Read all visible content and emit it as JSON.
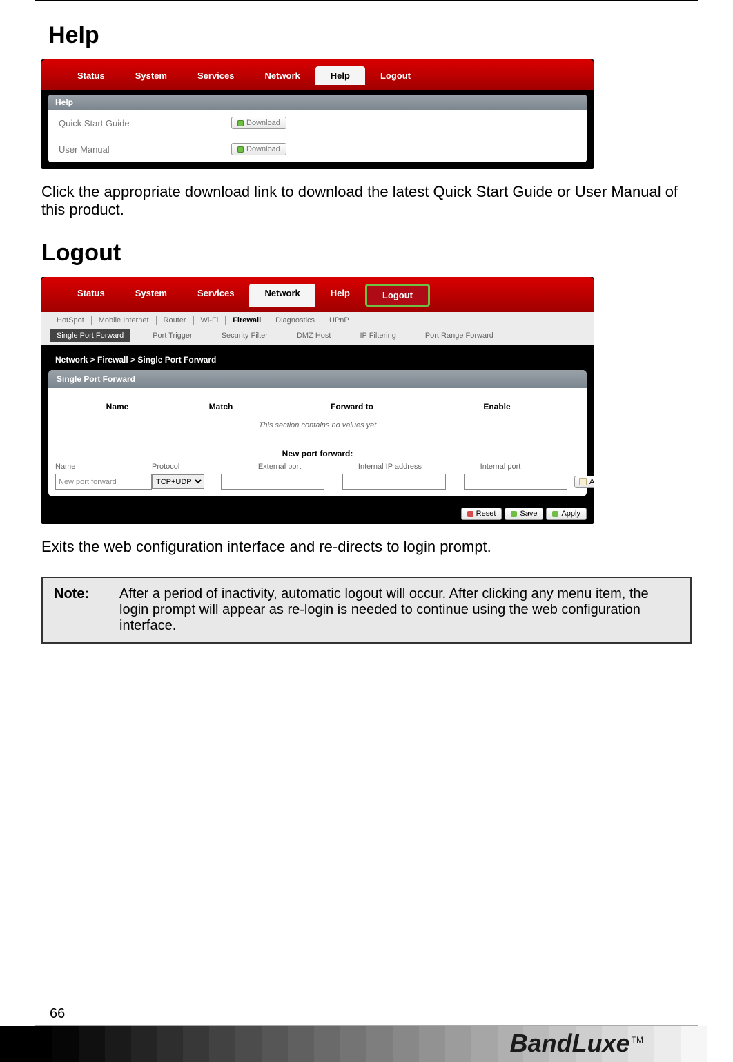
{
  "section1": {
    "title": "Help",
    "nav": {
      "items": [
        "Status",
        "System",
        "Services",
        "Network",
        "Help",
        "Logout"
      ],
      "active_index": 4
    },
    "inner_header": "Help",
    "rows": [
      {
        "label": "Quick Start Guide",
        "button": "Download"
      },
      {
        "label": "User Manual",
        "button": "Download"
      }
    ],
    "paragraph": "Click the appropriate download link to download the latest Quick Start Guide or User Manual of this product."
  },
  "section2": {
    "title": "Logout",
    "nav": {
      "items": [
        "Status",
        "System",
        "Services",
        "Network",
        "Help",
        "Logout"
      ],
      "active_index": 3,
      "highlight_index": 5
    },
    "subnav1": {
      "items": [
        "HotSpot",
        "Mobile Internet",
        "Router",
        "Wi-Fi",
        "Firewall",
        "Diagnostics",
        "UPnP"
      ],
      "active_index": 4
    },
    "subnav2": {
      "items": [
        "Single Port Forward",
        "Port Trigger",
        "Security Filter",
        "DMZ Host",
        "IP Filtering",
        "Port Range Forward"
      ],
      "active_index": 0
    },
    "breadcrumb": "Network > Firewall > Single Port Forward",
    "card_header": "Single Port Forward",
    "columns": [
      "Name",
      "Match",
      "Forward to",
      "Enable"
    ],
    "empty_text": "This section contains no values yet",
    "new_port_title": "New port forward:",
    "form_headers": [
      "Name",
      "Protocol",
      "External port",
      "Internal IP address",
      "Internal port"
    ],
    "form": {
      "name_placeholder": "New port forward",
      "protocol_value": "TCP+UDP",
      "add_button": "Add"
    },
    "buttons": {
      "reset": "Reset",
      "save": "Save",
      "apply": "Apply"
    },
    "paragraph": "Exits the web configuration interface and re-directs to login prompt."
  },
  "note": {
    "label": "Note:",
    "text": "After a period of inactivity, automatic logout will occur. After clicking any menu item, the login prompt will appear as re-login is needed to continue using the web configuration interface."
  },
  "footer": {
    "page_number": "66",
    "logo": "BandLuxe",
    "tm": "TM",
    "bar_colors": [
      "#000000",
      "#000000",
      "#060606",
      "#101010",
      "#1a1a1a",
      "#242424",
      "#2e2e2e",
      "#383838",
      "#424242",
      "#4c4c4c",
      "#565656",
      "#606060",
      "#6a6a6a",
      "#747474",
      "#7e7e7e",
      "#888888",
      "#929292",
      "#9c9c9c",
      "#a6a6a6",
      "#b0b0b0",
      "#bababa",
      "#c4c4c4",
      "#cecece",
      "#d8d8d8",
      "#e2e2e2",
      "#ececec",
      "#f6f6f6",
      "#ffffff"
    ]
  }
}
